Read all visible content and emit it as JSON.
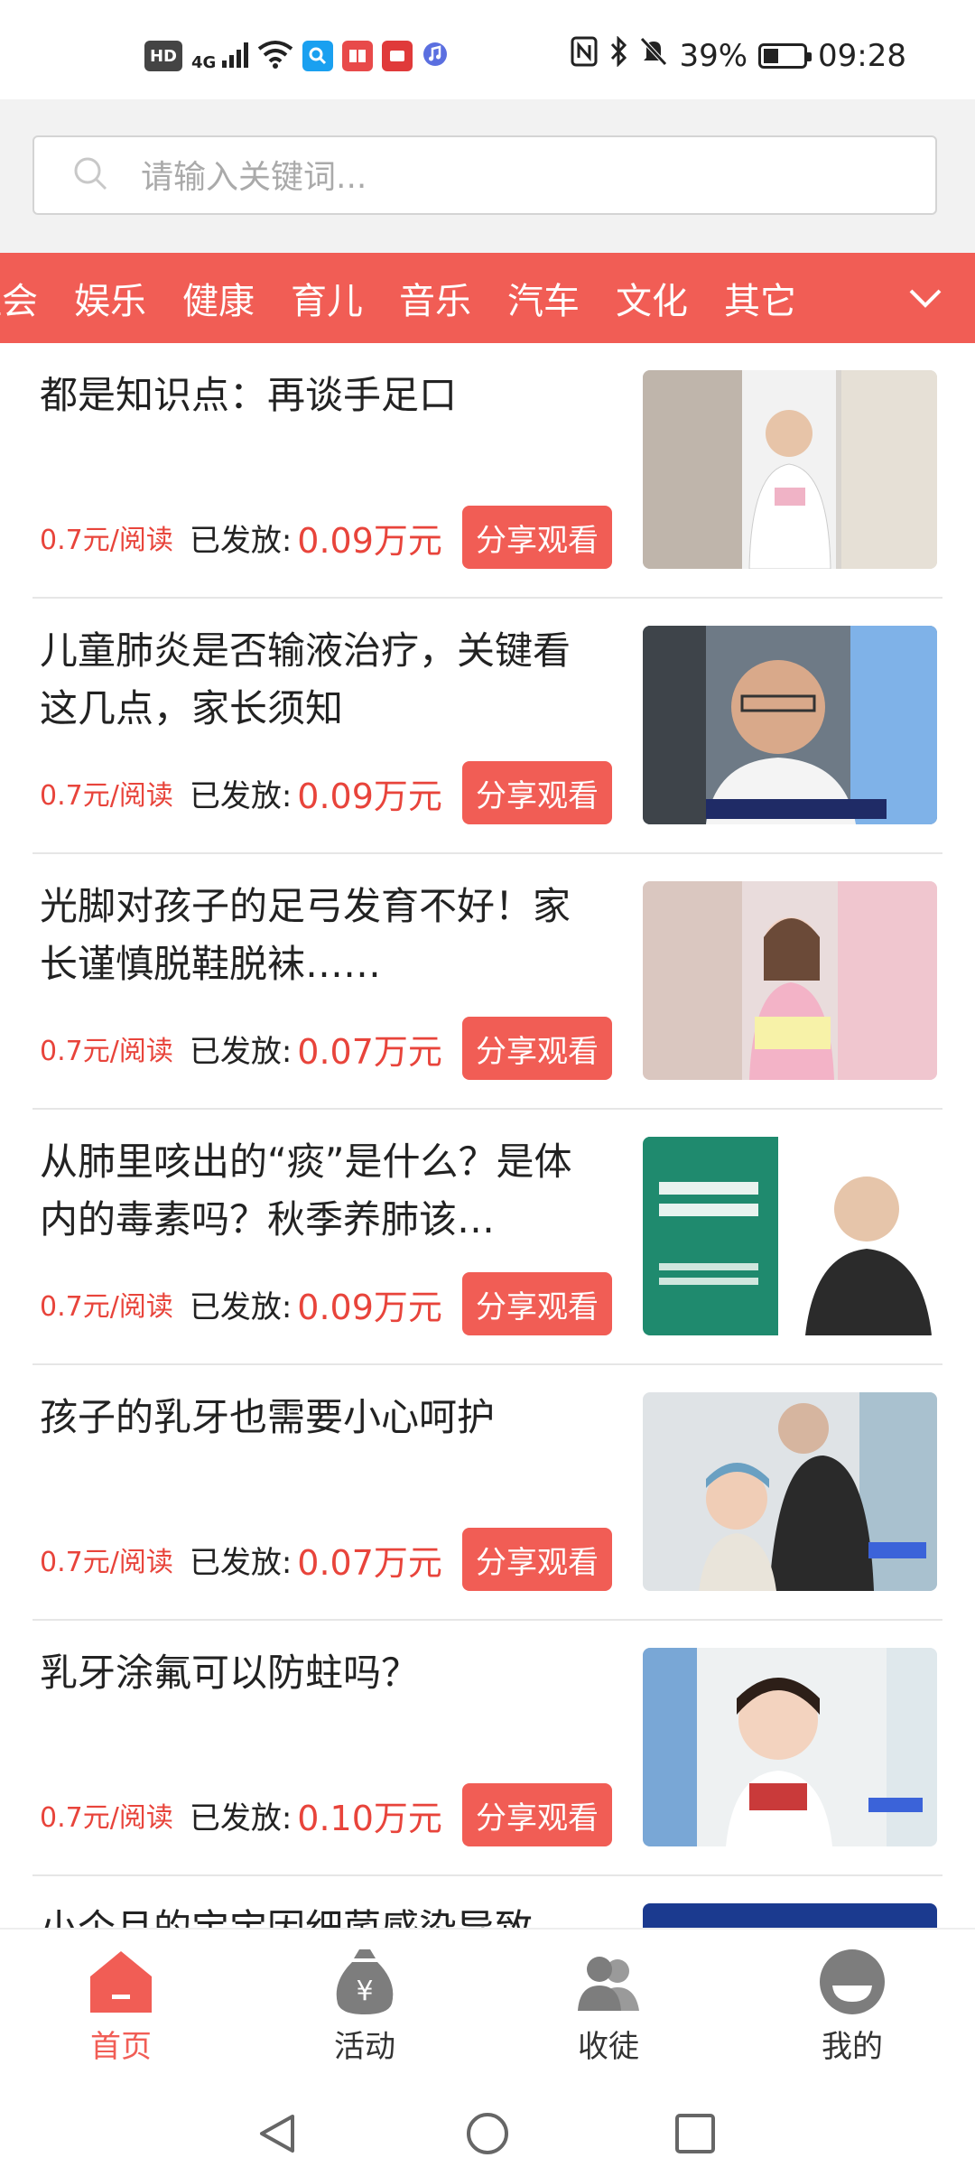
{
  "status_bar": {
    "left_icons": [
      "hd-icon",
      "signal-4g-icon",
      "wifi-icon",
      "app-search-icon",
      "app-reader-icon",
      "huawei-app-icon",
      "music-icon"
    ],
    "hd_label": "HD",
    "net_label": "4G",
    "right_icons": [
      "nfc-icon",
      "bluetooth-icon",
      "mute-icon"
    ],
    "battery_percent": "39%",
    "battery_level": 0.39,
    "time": "09:28"
  },
  "search": {
    "placeholder": "请输入关键词..."
  },
  "categories": {
    "items": [
      "社会",
      "娱乐",
      "健康",
      "育儿",
      "音乐",
      "汽车",
      "文化",
      "其它"
    ],
    "expand_icon": "chevron-down-icon"
  },
  "feed": {
    "price_label": "0.7元/阅读",
    "issued_label": "已发放:",
    "share_label": "分享观看",
    "items": [
      {
        "title": "都是知识点：再谈手足口",
        "issued": "0.09万元"
      },
      {
        "title": "儿童肺炎是否输液治疗，关键看这几点，家长须知",
        "issued": "0.09万元"
      },
      {
        "title": "光脚对孩子的足弓发育不好！家长谨慎脱鞋脱袜……",
        "issued": "0.07万元"
      },
      {
        "title": "从肺里咳出的“痰”是什么？是体内的毒素吗？秋季养肺该…",
        "issued": "0.09万元"
      },
      {
        "title": "孩子的乳牙也需要小心呵护",
        "issued": "0.07万元"
      },
      {
        "title": "乳牙涂氟可以防蛀吗？",
        "issued": "0.10万元"
      },
      {
        "title": "小个月的宝宝因细菌感染导致",
        "issued": ""
      }
    ]
  },
  "bottom_nav": {
    "items": [
      {
        "label": "首页",
        "icon": "home-icon",
        "active": true
      },
      {
        "label": "活动",
        "icon": "money-bag-icon",
        "active": false
      },
      {
        "label": "收徒",
        "icon": "users-icon",
        "active": false
      },
      {
        "label": "我的",
        "icon": "profile-icon",
        "active": false
      }
    ]
  },
  "colors": {
    "accent": "#f15d55",
    "price_red": "#e8443b"
  }
}
